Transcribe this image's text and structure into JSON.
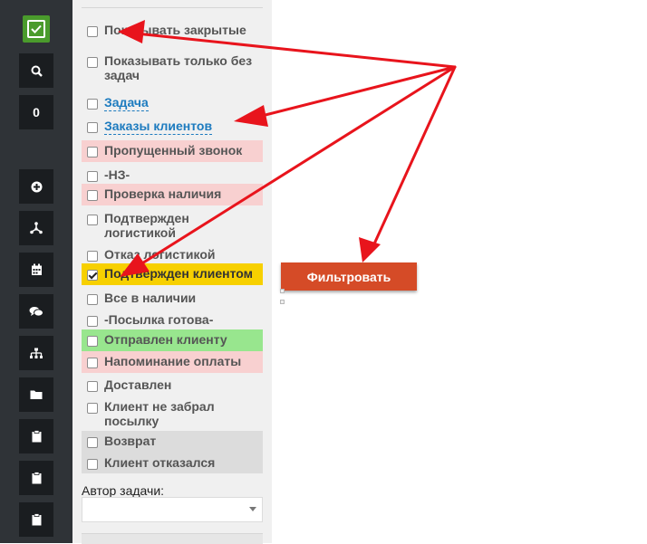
{
  "sidebar": {
    "badge_count": "0",
    "icons": [
      "checkbox-icon",
      "search-icon",
      "plus-circle-icon",
      "share-icon",
      "calendar-icon",
      "comments-icon",
      "sitemap-icon",
      "folder-icon",
      "clipboard-icon",
      "clipboard-icon",
      "clipboard-icon"
    ]
  },
  "filters": {
    "show_closed": "Показывать закрытые",
    "show_without_tasks": "Показывать только без задач",
    "task": "Задача",
    "client_orders": "Заказы клиентов",
    "statuses": [
      {
        "label": "Пропущенный звонок",
        "checked": false,
        "color": "#f8d0d0"
      },
      {
        "label": "-НЗ-",
        "checked": false,
        "color": ""
      },
      {
        "label": "Проверка наличия",
        "checked": false,
        "color": "#f8d0d0"
      },
      {
        "label": "Подтвержден логистикой",
        "checked": false,
        "color": ""
      },
      {
        "label": "Отказ логистикой",
        "checked": false,
        "color": ""
      },
      {
        "label": "Подтвержден клиентом",
        "checked": true,
        "color": "#f7d000"
      },
      {
        "label": "Все в наличии",
        "checked": false,
        "color": ""
      },
      {
        "label": "-Посылка готова-",
        "checked": false,
        "color": ""
      },
      {
        "label": "Отправлен клиенту",
        "checked": false,
        "color": "#98e68e"
      },
      {
        "label": "Напоминание оплаты",
        "checked": false,
        "color": "#f8d0d0"
      },
      {
        "label": "Доставлен",
        "checked": false,
        "color": ""
      },
      {
        "label": "Клиент не забрал посылку",
        "checked": false,
        "color": ""
      },
      {
        "label": "Возврат",
        "checked": false,
        "color": "#dcdcdc"
      },
      {
        "label": "Клиент отказался",
        "checked": false,
        "color": "#dcdcdc"
      }
    ],
    "author_label": "Автор задачи:",
    "author_value": ""
  },
  "actions": {
    "filter_button": "Фильтровать"
  },
  "annotation": {
    "arrow_color": "#e8141c"
  }
}
